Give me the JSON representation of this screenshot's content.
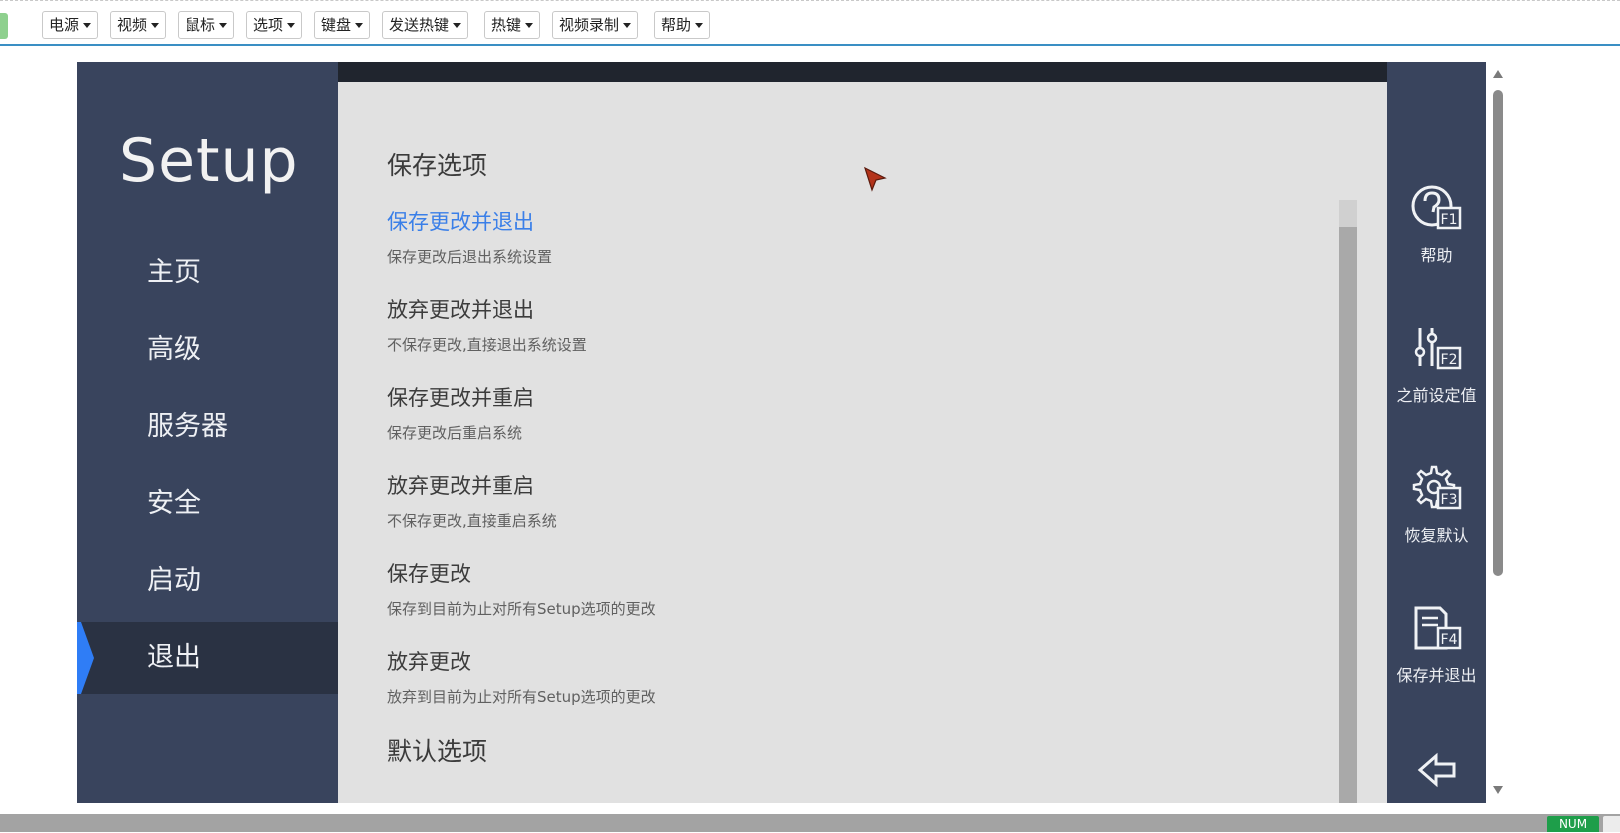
{
  "toolbar": {
    "menus": [
      "电源",
      "视频",
      "鼠标",
      "选项",
      "键盘",
      "发送热键",
      "热键",
      "视频录制",
      "帮助"
    ]
  },
  "bios": {
    "brand": "Setup",
    "nav": [
      "主页",
      "高级",
      "服务器",
      "安全",
      "启动",
      "退出"
    ],
    "active_nav": "退出",
    "sections": {
      "save_title": "保存选项",
      "default_title": "默认选项"
    },
    "options": [
      {
        "title": "保存更改并退出",
        "desc": "保存更改后退出系统设置",
        "selected": true
      },
      {
        "title": "放弃更改并退出",
        "desc": "不保存更改,直接退出系统设置",
        "selected": false
      },
      {
        "title": "保存更改并重启",
        "desc": "保存更改后重启系统",
        "selected": false
      },
      {
        "title": "放弃更改并重启",
        "desc": "不保存更改,直接重启系统",
        "selected": false
      },
      {
        "title": "保存更改",
        "desc": "保存到目前为止对所有Setup选项的更改",
        "selected": false
      },
      {
        "title": "放弃更改",
        "desc": "放弃到目前为止对所有Setup选项的更改",
        "selected": false
      }
    ],
    "fkeys": [
      {
        "key": "F1",
        "label": "帮助",
        "icon": "help-icon"
      },
      {
        "key": "F2",
        "label": "之前设定值",
        "icon": "sliders-icon"
      },
      {
        "key": "F3",
        "label": "恢复默认",
        "icon": "gear-icon"
      },
      {
        "key": "F4",
        "label": "保存并退出",
        "icon": "save-document-icon"
      }
    ],
    "colors": {
      "sidebar": "#39445d",
      "active_nav": "#2a3243",
      "accent": "#2f7df6",
      "selected_text": "#3a7fe8",
      "content_bg": "#e1e1e1"
    }
  },
  "status": {
    "num_lock": "NUM"
  }
}
